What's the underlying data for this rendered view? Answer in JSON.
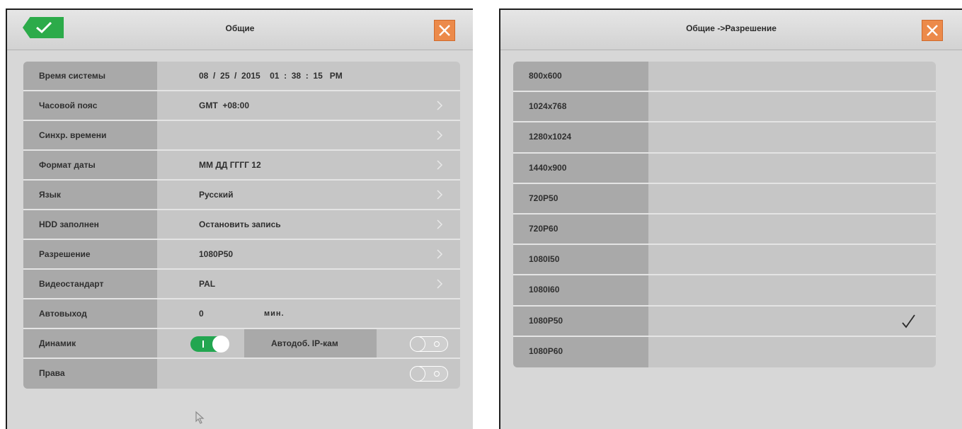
{
  "general": {
    "title": "Общие",
    "rows": [
      {
        "label": "Время системы",
        "value": "08  /  25  /  2015    01  :  38  :  15   PM"
      },
      {
        "label": "Часовой пояс",
        "value": "GMT  +08:00"
      },
      {
        "label": "Синхр. времени",
        "value": ""
      },
      {
        "label": "Формат даты",
        "value": "ММ ДД ГГГГ 12"
      },
      {
        "label": "Язык",
        "value": "Русский"
      },
      {
        "label": "HDD заполнен",
        "value": "Остановить запись"
      },
      {
        "label": "Разрешение",
        "value": "1080P50"
      },
      {
        "label": "Видеостандарт",
        "value": "PAL"
      }
    ],
    "autoexit": {
      "label": "Автовыход",
      "value": "0",
      "unit": "мин."
    },
    "speaker": {
      "label": "Динамик",
      "on": true
    },
    "auto_ipcam": {
      "label": "Автодоб. IP-кам",
      "on": false
    },
    "rights": {
      "label": "Права",
      "on": false
    }
  },
  "resolution": {
    "title": "Общие ->Разрешение",
    "options": [
      "800x600",
      "1024x768",
      "1280x1024",
      "1440x900",
      "720P50",
      "720P60",
      "1080I50",
      "1080I60",
      "1080P50",
      "1080P60"
    ],
    "selected": "1080P50"
  },
  "colors": {
    "accent_green": "#2cab4a",
    "close_orange": "#ec8a4a",
    "panel": "#d7d7d7",
    "label_bg": "#a9a9a9",
    "value_bg": "#c6c6c6"
  }
}
